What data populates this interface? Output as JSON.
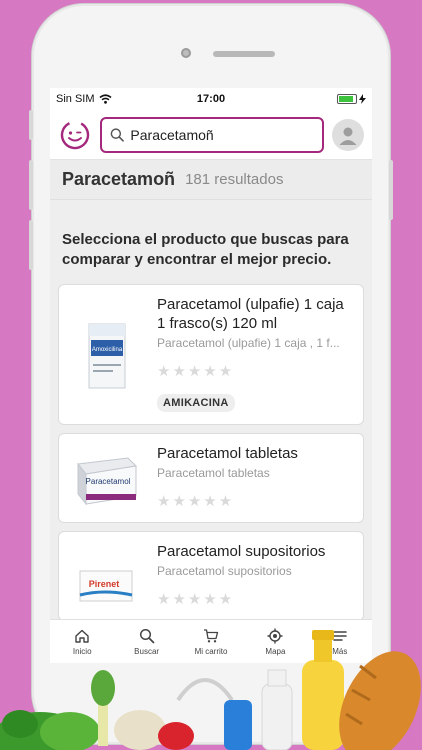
{
  "status_bar": {
    "carrier": "Sin SIM",
    "time": "17:00"
  },
  "header": {
    "search_value": "Paracetamoñ"
  },
  "results": {
    "term": "Paracetamoñ",
    "count_text": "181 resultados"
  },
  "intro_text": "Selecciona el producto que buscas para comparar y encontrar el mejor precio.",
  "products": [
    {
      "title": "Paracetamol (ulpafie) 1 caja 1 frasco(s) 120 ml",
      "subtitle": "Paracetamol (ulpafie) 1 caja , 1 f...",
      "stars": "★★★★★",
      "tag": "AMIKACINA",
      "image_label": "Amoxicilina"
    },
    {
      "title": "Paracetamol tabletas",
      "subtitle": "Paracetamol tabletas",
      "stars": "★★★★★",
      "image_label": "Paracetamol"
    },
    {
      "title": "Paracetamol supositorios",
      "subtitle": "Paracetamol supositorios",
      "stars": "★★★★★",
      "image_label": "Pirenet"
    }
  ],
  "tabbar": {
    "items": [
      {
        "label": "Inicio",
        "icon": "home-icon"
      },
      {
        "label": "Buscar",
        "icon": "search-icon"
      },
      {
        "label": "Mi carrito",
        "icon": "cart-icon"
      },
      {
        "label": "Mapa",
        "icon": "map-target-icon"
      },
      {
        "label": "Más",
        "icon": "menu-icon"
      }
    ]
  },
  "colors": {
    "background": "#d678c2",
    "accent": "#a4287c",
    "battery": "#3cc23c"
  }
}
